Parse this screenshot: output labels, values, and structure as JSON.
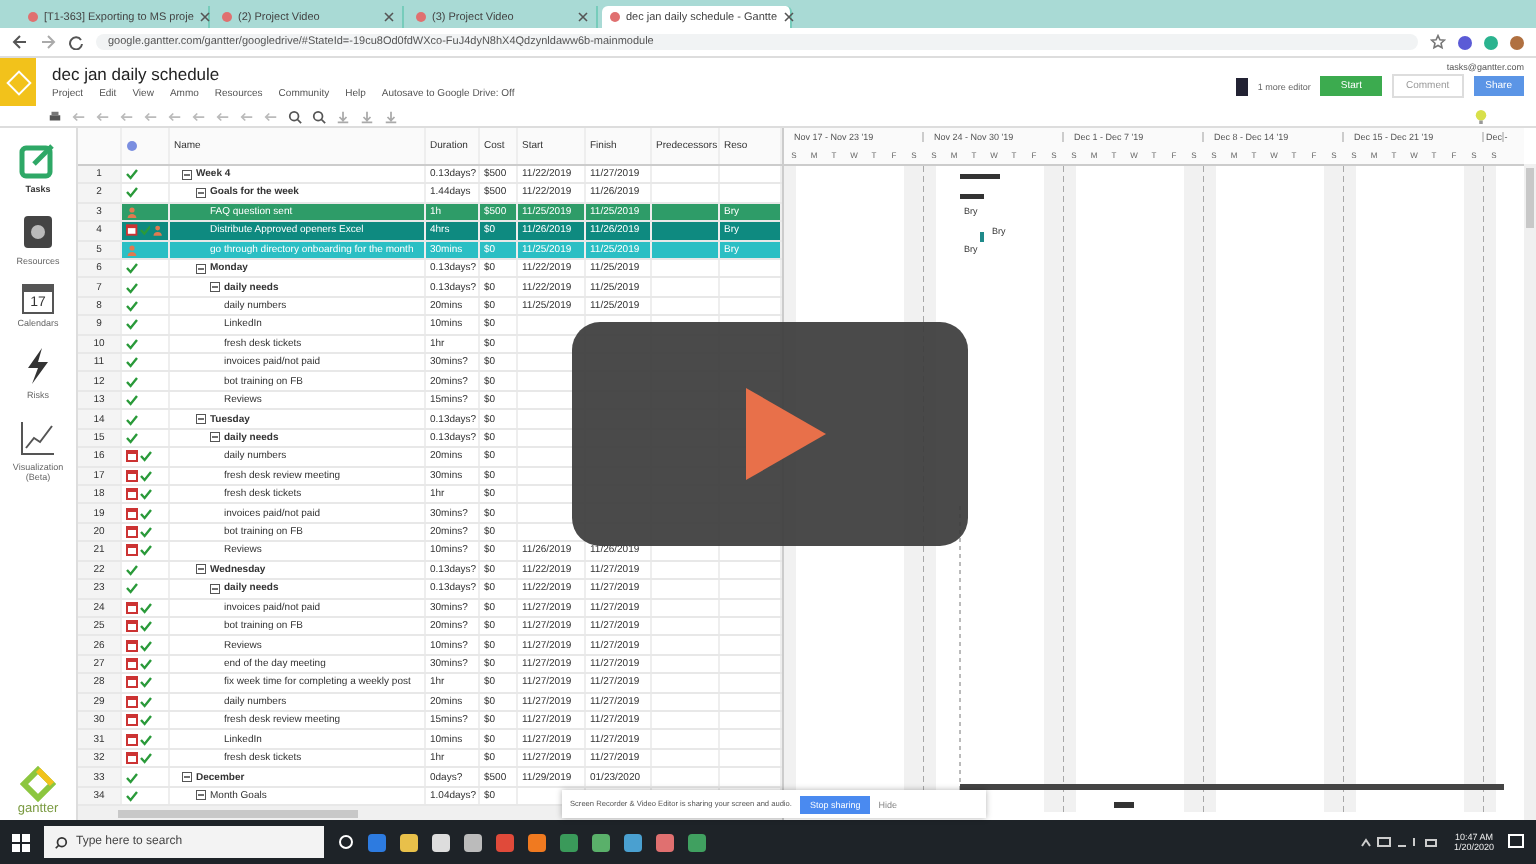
{
  "browser": {
    "tabs": [
      {
        "label": "[T1-363] Exporting to MS proje",
        "selected": false
      },
      {
        "label": "(2) Project Video",
        "selected": false
      },
      {
        "label": "(3) Project Video",
        "selected": false
      },
      {
        "label": "dec jan daily schedule - Gantte",
        "selected": true
      }
    ],
    "url": "google.gantter.com/gantter/googledrive/#StateId=-19cu8Od0fdWXco-FuJ4dyN8hX4Qdzynldaww6b-mainmodule"
  },
  "app": {
    "title": "dec jan daily schedule",
    "menu": [
      "Project",
      "Edit",
      "View",
      "Ammo",
      "Resources",
      "Community",
      "Help"
    ],
    "autosave": "Autosave to Google Drive: Off",
    "account": "tasks@gantter.com",
    "editors": "1 more editor",
    "buttons": [
      "Start",
      "Comment",
      "Share"
    ]
  },
  "sidebar": {
    "items": [
      {
        "label": "Tasks",
        "kind": "tasks",
        "selected": true
      },
      {
        "label": "Resources",
        "kind": "resources",
        "selected": false
      },
      {
        "label": "Calendars",
        "kind": "calendar",
        "badge": "17",
        "selected": false
      },
      {
        "label": "Risks",
        "kind": "risks",
        "selected": false
      },
      {
        "label": "Visualization (Beta)",
        "kind": "chart",
        "selected": false
      }
    ],
    "logo": "gantter"
  },
  "table": {
    "columns": [
      "Name",
      "Duration",
      "Cost",
      "Start",
      "Finish",
      "Predecessors",
      "Reso"
    ],
    "rows": [
      {
        "num": "1",
        "name": "Week 4",
        "duration": "0.13days?",
        "cost": "$500",
        "start": "11/22/2019",
        "finish": "11/27/2019",
        "check": true,
        "expanded": true,
        "children": [
          {
            "num": "2",
            "name": "Goals for the week",
            "duration": "1.44days",
            "cost": "$500",
            "start": "11/22/2019",
            "finish": "11/26/2019",
            "check": true,
            "expanded": true,
            "children": [
              {
                "num": "3",
                "name": "FAQ question sent",
                "duration": "1h",
                "cost": "$500",
                "start": "11/25/2019",
                "finish": "11/25/2019",
                "resource": "Bry",
                "gantt_label": "Bry",
                "person": true,
                "color": "#2e9c68"
              },
              {
                "num": "4",
                "name": "Distribute Approved openers Excel",
                "duration": "4hrs",
                "cost": "$0",
                "start": "11/26/2019",
                "finish": "11/26/2019",
                "resource": "Bry",
                "gantt_label": "Bry",
                "calendar": true,
                "check": true,
                "person": true,
                "color": "#0e8a80"
              },
              {
                "num": "5",
                "name": "go through directory onboarding for the month",
                "duration": "30mins",
                "cost": "$0",
                "start": "11/25/2019",
                "finish": "11/25/2019",
                "resource": "Bry",
                "gantt_label": "Bry",
                "person": true,
                "color": "#2bbfc4"
              }
            ]
          },
          {
            "num": "6",
            "name": "Monday",
            "duration": "0.13days?",
            "cost": "$0",
            "start": "11/22/2019",
            "finish": "11/25/2019",
            "check": true,
            "expanded": true,
            "children": [
              {
                "num": "7",
                "name": "daily needs",
                "duration": "0.13days?",
                "cost": "$0",
                "start": "11/22/2019",
                "finish": "11/25/2019",
                "check": true,
                "expanded": true,
                "children": [
                  {
                    "num": "8",
                    "name": "daily numbers",
                    "duration": "20mins",
                    "cost": "$0",
                    "start": "11/25/2019",
                    "finish": "11/25/2019",
                    "check": true
                  },
                  {
                    "num": "9",
                    "name": "LinkedIn",
                    "duration": "10mins",
                    "cost": "$0",
                    "check": true
                  },
                  {
                    "num": "10",
                    "name": "fresh desk tickets",
                    "duration": "1hr",
                    "cost": "$0",
                    "check": true
                  },
                  {
                    "num": "11",
                    "name": "invoices paid/not paid",
                    "duration": "30mins?",
                    "cost": "$0",
                    "check": true
                  },
                  {
                    "num": "12",
                    "name": "bot training on FB",
                    "duration": "20mins?",
                    "cost": "$0",
                    "check": true
                  },
                  {
                    "num": "13",
                    "name": "Reviews",
                    "duration": "15mins?",
                    "cost": "$0",
                    "check": true
                  }
                ]
              }
            ]
          },
          {
            "num": "14",
            "name": "Tuesday",
            "duration": "0.13days?",
            "cost": "$0",
            "check": true,
            "expanded": true,
            "children": [
              {
                "num": "15",
                "name": "daily needs",
                "duration": "0.13days?",
                "cost": "$0",
                "check": true,
                "expanded": true,
                "children": [
                  {
                    "num": "16",
                    "name": "daily numbers",
                    "duration": "20mins",
                    "cost": "$0",
                    "calendar": true,
                    "check": true
                  },
                  {
                    "num": "17",
                    "name": "fresh desk review meeting",
                    "duration": "30mins",
                    "cost": "$0",
                    "calendar": true,
                    "check": true
                  },
                  {
                    "num": "18",
                    "name": "fresh desk tickets",
                    "duration": "1hr",
                    "cost": "$0",
                    "calendar": true,
                    "check": true
                  },
                  {
                    "num": "19",
                    "name": "invoices paid/not paid",
                    "duration": "30mins?",
                    "cost": "$0",
                    "calendar": true,
                    "check": true
                  },
                  {
                    "num": "20",
                    "name": "bot training on FB",
                    "duration": "20mins?",
                    "cost": "$0",
                    "calendar": true,
                    "check": true
                  },
                  {
                    "num": "21",
                    "name": "Reviews",
                    "duration": "10mins?",
                    "cost": "$0",
                    "start": "11/26/2019",
                    "finish": "11/26/2019",
                    "calendar": true,
                    "check": true
                  }
                ]
              }
            ]
          },
          {
            "num": "22",
            "name": "Wednesday",
            "duration": "0.13days?",
            "cost": "$0",
            "start": "11/22/2019",
            "finish": "11/27/2019",
            "check": true,
            "expanded": true,
            "children": [
              {
                "num": "23",
                "name": "daily needs",
                "duration": "0.13days?",
                "cost": "$0",
                "start": "11/22/2019",
                "finish": "11/27/2019",
                "check": true,
                "expanded": true,
                "children": [
                  {
                    "num": "24",
                    "name": "invoices paid/not paid",
                    "duration": "30mins?",
                    "cost": "$0",
                    "start": "11/27/2019",
                    "finish": "11/27/2019",
                    "calendar": true,
                    "check": true
                  },
                  {
                    "num": "25",
                    "name": "bot training on FB",
                    "duration": "20mins?",
                    "cost": "$0",
                    "start": "11/27/2019",
                    "finish": "11/27/2019",
                    "calendar": true,
                    "check": true
                  },
                  {
                    "num": "26",
                    "name": "Reviews",
                    "duration": "10mins?",
                    "cost": "$0",
                    "start": "11/27/2019",
                    "finish": "11/27/2019",
                    "calendar": true,
                    "check": true
                  },
                  {
                    "num": "27",
                    "name": "end of the day meeting",
                    "duration": "30mins?",
                    "cost": "$0",
                    "start": "11/27/2019",
                    "finish": "11/27/2019",
                    "calendar": true,
                    "check": true
                  },
                  {
                    "num": "28",
                    "name": "fix week time for completing a weekly post",
                    "duration": "1hr",
                    "cost": "$0",
                    "start": "11/27/2019",
                    "finish": "11/27/2019",
                    "calendar": true,
                    "check": true
                  },
                  {
                    "num": "29",
                    "name": "daily numbers",
                    "duration": "20mins",
                    "cost": "$0",
                    "start": "11/27/2019",
                    "finish": "11/27/2019",
                    "calendar": true,
                    "check": true
                  },
                  {
                    "num": "30",
                    "name": "fresh desk review meeting",
                    "duration": "15mins?",
                    "cost": "$0",
                    "start": "11/27/2019",
                    "finish": "11/27/2019",
                    "calendar": true,
                    "check": true
                  },
                  {
                    "num": "31",
                    "name": "LinkedIn",
                    "duration": "10mins",
                    "cost": "$0",
                    "start": "11/27/2019",
                    "finish": "11/27/2019",
                    "calendar": true,
                    "check": true
                  },
                  {
                    "num": "32",
                    "name": "fresh desk tickets",
                    "duration": "1hr",
                    "cost": "$0",
                    "start": "11/27/2019",
                    "finish": "11/27/2019",
                    "calendar": true,
                    "check": true
                  }
                ]
              }
            ]
          }
        ]
      },
      {
        "num": "33",
        "name": "December",
        "duration": "0days?",
        "cost": "$500",
        "start": "11/29/2019",
        "finish": "01/23/2020",
        "check": true,
        "expanded": true,
        "children": [
          {
            "num": "34",
            "name": "Month Goals",
            "duration": "1.04days?",
            "cost": "$0",
            "check": true,
            "expanded": true
          }
        ]
      }
    ]
  },
  "gantt": {
    "weeks": [
      {
        "label": "Nov 17 - Nov 23 '19",
        "days": [
          "S",
          "M",
          "T",
          "W",
          "T",
          "F",
          "S"
        ]
      },
      {
        "label": "Nov 24 - Nov 30 '19",
        "days": [
          "S",
          "M",
          "T",
          "W",
          "T",
          "F",
          "S"
        ]
      },
      {
        "label": "Dec 1 - Dec 7 '19",
        "days": [
          "S",
          "M",
          "T",
          "W",
          "T",
          "F",
          "S"
        ]
      },
      {
        "label": "Dec 8 - Dec 14 '19",
        "days": [
          "S",
          "M",
          "T",
          "W",
          "T",
          "F",
          "S"
        ]
      },
      {
        "label": "Dec 15 - Dec 21 '19",
        "days": [
          "S",
          "M",
          "T",
          "W",
          "T",
          "F",
          "S"
        ]
      },
      {
        "label": "Dec -",
        "days": [
          "S"
        ]
      }
    ]
  },
  "share_bar": {
    "message": "Screen Recorder & Video Editor is sharing your screen and audio.",
    "stop": "Stop sharing",
    "hide": "Hide"
  },
  "taskbar": {
    "search_placeholder": "Type here to search",
    "time": "10:47 AM",
    "date": "1/20/2020"
  }
}
